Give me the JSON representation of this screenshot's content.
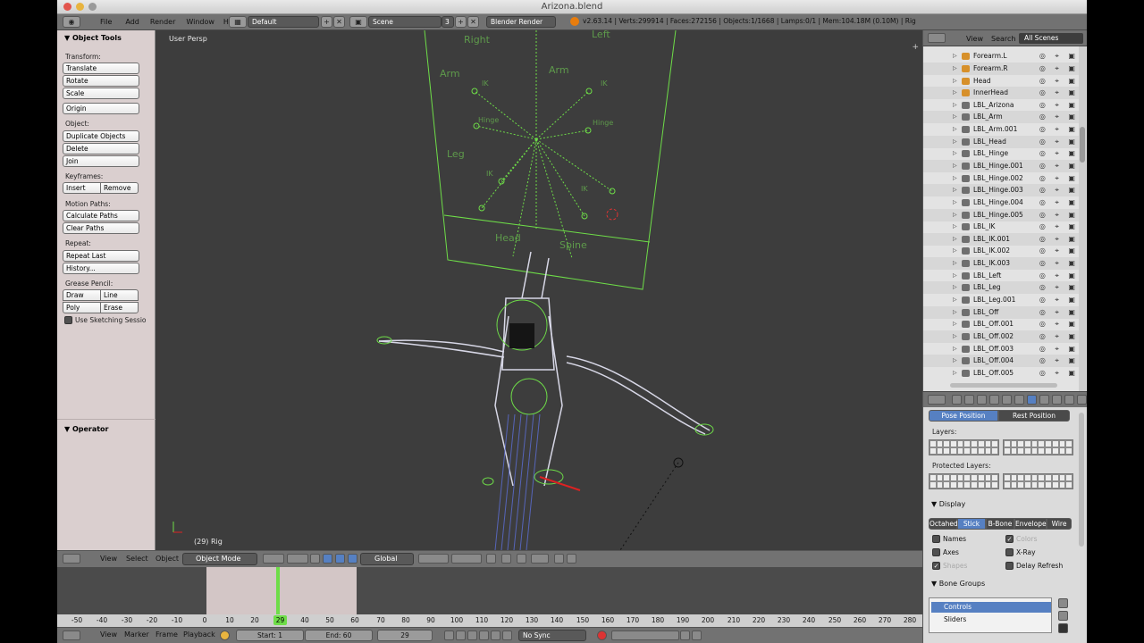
{
  "window": {
    "title": "Arizona.blend"
  },
  "info_header": {
    "menus": [
      "File",
      "Add",
      "Render",
      "Window",
      "Help"
    ],
    "screen_layout": "Default",
    "scene": "Scene",
    "scene_users": "3",
    "render_engine": "Blender Render",
    "stats": "v2.63.14 | Verts:299914 | Faces:272156 | Objects:1/1668 | Lamps:0/1 | Mem:104.18M (0.10M) | Rig"
  },
  "tool_shelf": {
    "title": "Object Tools",
    "transform_label": "Transform:",
    "translate": "Translate",
    "rotate": "Rotate",
    "scale": "Scale",
    "origin": "Origin",
    "object_label": "Object:",
    "duplicate": "Duplicate Objects",
    "delete": "Delete",
    "join": "Join",
    "keyframes_label": "Keyframes:",
    "insert": "Insert",
    "remove": "Remove",
    "motion_paths_label": "Motion Paths:",
    "calculate_paths": "Calculate Paths",
    "clear_paths": "Clear Paths",
    "repeat_label": "Repeat:",
    "repeat_last": "Repeat Last",
    "history": "History...",
    "grease_pencil_label": "Grease Pencil:",
    "draw": "Draw",
    "line": "Line",
    "poly": "Poly",
    "erase": "Erase",
    "sketching": "Use Sketching Sessio",
    "operator": "Operator"
  },
  "viewport": {
    "view_name": "User Persp",
    "frame_info": "(29) Rig",
    "rig_labels": [
      "Right",
      "Left",
      "Arm",
      "Arm",
      "IK",
      "IK",
      "Hinge",
      "Hinge",
      "Leg",
      "IK",
      "IK",
      "Head",
      "Spine"
    ]
  },
  "view3d_header": {
    "view": "View",
    "select": "Select",
    "object": "Object",
    "mode": "Object Mode",
    "orientation": "Global"
  },
  "timeline": {
    "ticks": [
      "-50",
      "-40",
      "-30",
      "-20",
      "-10",
      "0",
      "10",
      "20",
      "30",
      "40",
      "50",
      "60",
      "70",
      "80",
      "90",
      "100",
      "110",
      "120",
      "130",
      "140",
      "150",
      "160",
      "170",
      "180",
      "190",
      "200",
      "210",
      "220",
      "230",
      "240",
      "250",
      "260",
      "270",
      "280"
    ],
    "current_frame": "29",
    "view": "View",
    "marker": "Marker",
    "frame": "Frame",
    "playback": "Playback",
    "start": "Start: 1",
    "end": "End: 60",
    "current": "29",
    "sync": "No Sync"
  },
  "outliner": {
    "view": "View",
    "search": "Search",
    "scenes": "All Scenes",
    "items": [
      "Forearm.L",
      "Forearm.R",
      "Head",
      "InnerHead",
      "LBL_Arizona",
      "LBL_Arm",
      "LBL_Arm.001",
      "LBL_Head",
      "LBL_Hinge",
      "LBL_Hinge.001",
      "LBL_Hinge.002",
      "LBL_Hinge.003",
      "LBL_Hinge.004",
      "LBL_Hinge.005",
      "LBL_IK",
      "LBL_IK.001",
      "LBL_IK.002",
      "LBL_IK.003",
      "LBL_Left",
      "LBL_Leg",
      "LBL_Leg.001",
      "LBL_Off",
      "LBL_Off.001",
      "LBL_Off.002",
      "LBL_Off.003",
      "LBL_Off.004",
      "LBL_Off.005"
    ]
  },
  "properties": {
    "pose_position": "Pose Position",
    "rest_position": "Rest Position",
    "layers": "Layers:",
    "protected_layers": "Protected Layers:",
    "display": "Display",
    "display_modes": [
      "Octahed",
      "Stick",
      "B-Bone",
      "Envelope",
      "Wire"
    ],
    "active_display": "Stick",
    "names": "Names",
    "colors": "Colors",
    "axes": "Axes",
    "xray": "X-Ray",
    "shapes": "Shapes",
    "delay_refresh": "Delay Refresh",
    "bone_groups": "Bone Groups",
    "groups": [
      "Controls",
      "Sliders"
    ]
  },
  "colors": {
    "accent": "#5680c2",
    "rig_green": "#6edd48",
    "viewport_bg": "#3d3d3d"
  }
}
